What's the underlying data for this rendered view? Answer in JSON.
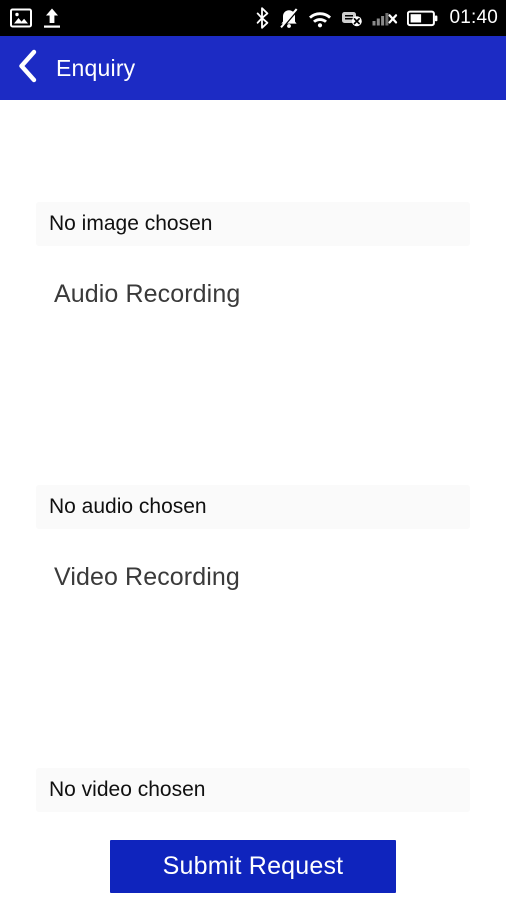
{
  "statusbar": {
    "left_icons": [
      {
        "name": "image-icon",
        "label": "screenshot saved"
      },
      {
        "name": "upload-icon",
        "label": "upload in progress"
      }
    ],
    "right_icons": [
      {
        "name": "bluetooth-icon",
        "label": "bluetooth on"
      },
      {
        "name": "mute-icon",
        "label": "ringer silenced"
      },
      {
        "name": "wifi-icon",
        "label": "wifi connected"
      },
      {
        "name": "sync-disabled-icon",
        "label": "sync off"
      },
      {
        "name": "signal-off-icon",
        "label": "no mobile signal"
      },
      {
        "name": "battery-icon",
        "label": "battery"
      }
    ],
    "clock": "01:40",
    "background_color": "#000000",
    "foreground_color": "#ffffff"
  },
  "appbar": {
    "back_icon": "chevron-left-icon",
    "title": "Enquiry",
    "background_color": "#1c2bc4",
    "text_color": "#ffffff"
  },
  "form": {
    "image_field": {
      "value": "No image chosen",
      "background_color": "#fafafa"
    },
    "audio_section": {
      "label": "Audio Recording",
      "field_value": "No audio chosen"
    },
    "video_section": {
      "label": "Video Recording",
      "field_value": "No video chosen"
    },
    "submit": {
      "label": "Submit Request",
      "background_color": "#0f24bd",
      "text_color": "#ffffff"
    }
  }
}
